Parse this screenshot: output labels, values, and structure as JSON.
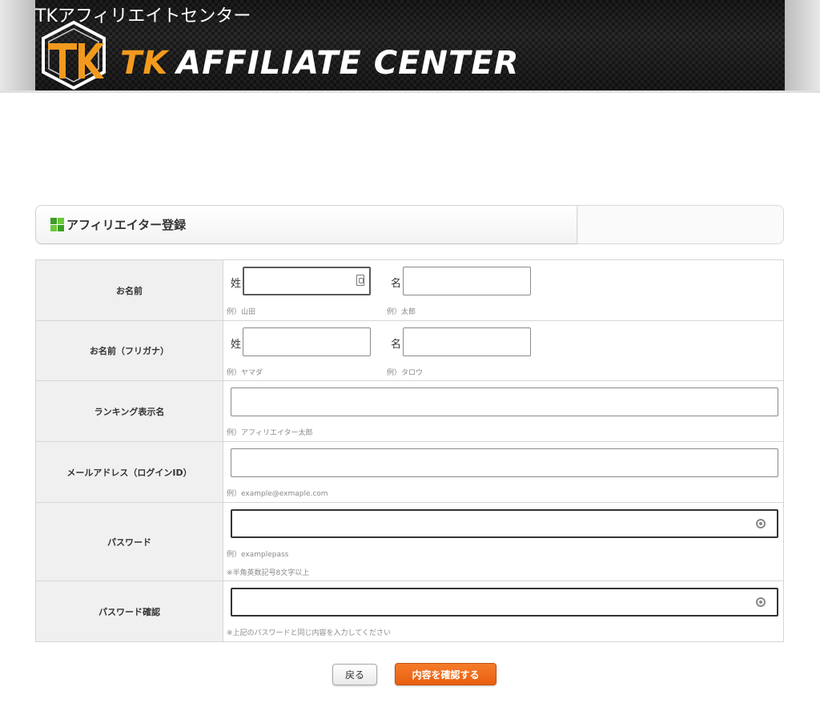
{
  "header": {
    "site_title": "TKアフィリエイトセンター",
    "logo_tk": "TK",
    "logo_rest": "AFFILIATE CENTER",
    "accent_color": "#f39a1e"
  },
  "section": {
    "title": "アフィリエイター登録",
    "icon": "green-squares-icon"
  },
  "form": {
    "name": {
      "label": "お名前",
      "last_kanji": "姓",
      "first_kanji": "名",
      "last_hint": "例）山田",
      "first_hint": "例）太郎",
      "last_value": "",
      "first_value": ""
    },
    "name_kana": {
      "label": "お名前（フリガナ）",
      "last_kanji": "姓",
      "first_kanji": "名",
      "last_hint": "例）ヤマダ",
      "first_hint": "例）タロウ",
      "last_value": "",
      "first_value": ""
    },
    "ranking_name": {
      "label": "ランキング表示名",
      "hint": "例）アフィリエイター太郎",
      "value": ""
    },
    "email": {
      "label": "メールアドレス（ログインID）",
      "hint": "例）example@exmaple.com",
      "value": ""
    },
    "password": {
      "label": "パスワード",
      "hint": "例）examplepass",
      "note": "※半角英数記号8文字以上",
      "value": ""
    },
    "password_confirm": {
      "label": "パスワード確認",
      "note": "※上記のパスワードと同じ内容を入力してください",
      "value": ""
    }
  },
  "buttons": {
    "back": "戻る",
    "confirm": "内容を確認する",
    "confirm_color": "#ee6a1a"
  }
}
